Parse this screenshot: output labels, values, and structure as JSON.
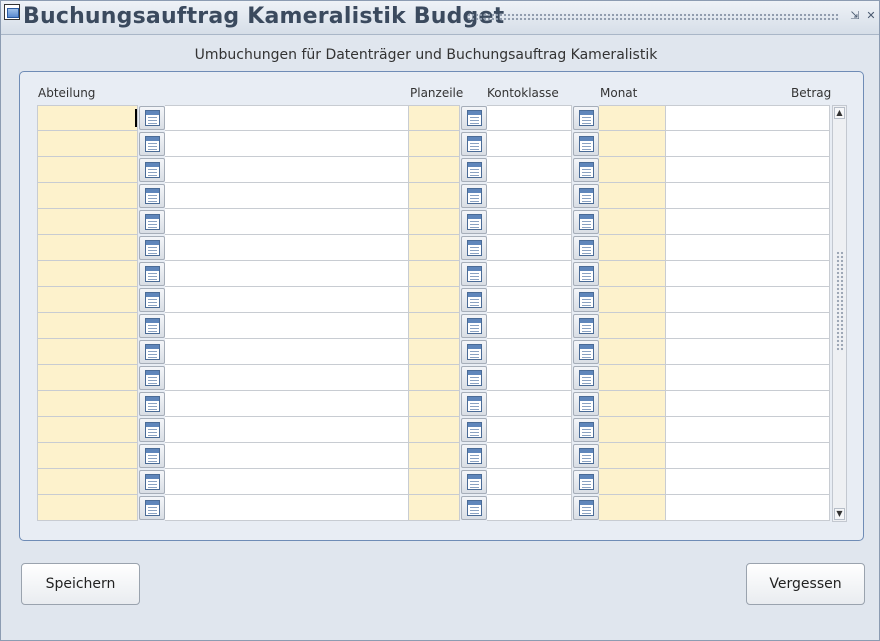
{
  "window": {
    "title": "Buchungsauftrag Kameralistik Budget",
    "minimize_glyph": "⇲",
    "close_glyph": "✕"
  },
  "subtitle": "Umbuchungen für Datenträger und Buchungsauftrag Kameralistik",
  "columns": {
    "abteilung": "Abteilung",
    "planzeile": "Planzeile",
    "kontoklasse": "Kontoklasse",
    "monat": "Monat",
    "betrag": "Betrag"
  },
  "rows": [
    {
      "abteilung": "",
      "abteilung_text": "",
      "planzeile": "",
      "kontoklasse": "",
      "monat": "",
      "betrag": ""
    },
    {
      "abteilung": "",
      "abteilung_text": "",
      "planzeile": "",
      "kontoklasse": "",
      "monat": "",
      "betrag": ""
    },
    {
      "abteilung": "",
      "abteilung_text": "",
      "planzeile": "",
      "kontoklasse": "",
      "monat": "",
      "betrag": ""
    },
    {
      "abteilung": "",
      "abteilung_text": "",
      "planzeile": "",
      "kontoklasse": "",
      "monat": "",
      "betrag": ""
    },
    {
      "abteilung": "",
      "abteilung_text": "",
      "planzeile": "",
      "kontoklasse": "",
      "monat": "",
      "betrag": ""
    },
    {
      "abteilung": "",
      "abteilung_text": "",
      "planzeile": "",
      "kontoklasse": "",
      "monat": "",
      "betrag": ""
    },
    {
      "abteilung": "",
      "abteilung_text": "",
      "planzeile": "",
      "kontoklasse": "",
      "monat": "",
      "betrag": ""
    },
    {
      "abteilung": "",
      "abteilung_text": "",
      "planzeile": "",
      "kontoklasse": "",
      "monat": "",
      "betrag": ""
    },
    {
      "abteilung": "",
      "abteilung_text": "",
      "planzeile": "",
      "kontoklasse": "",
      "monat": "",
      "betrag": ""
    },
    {
      "abteilung": "",
      "abteilung_text": "",
      "planzeile": "",
      "kontoklasse": "",
      "monat": "",
      "betrag": ""
    },
    {
      "abteilung": "",
      "abteilung_text": "",
      "planzeile": "",
      "kontoklasse": "",
      "monat": "",
      "betrag": ""
    },
    {
      "abteilung": "",
      "abteilung_text": "",
      "planzeile": "",
      "kontoklasse": "",
      "monat": "",
      "betrag": ""
    },
    {
      "abteilung": "",
      "abteilung_text": "",
      "planzeile": "",
      "kontoklasse": "",
      "monat": "",
      "betrag": ""
    },
    {
      "abteilung": "",
      "abteilung_text": "",
      "planzeile": "",
      "kontoklasse": "",
      "monat": "",
      "betrag": ""
    },
    {
      "abteilung": "",
      "abteilung_text": "",
      "planzeile": "",
      "kontoklasse": "",
      "monat": "",
      "betrag": ""
    },
    {
      "abteilung": "",
      "abteilung_text": "",
      "planzeile": "",
      "kontoklasse": "",
      "monat": "",
      "betrag": ""
    }
  ],
  "buttons": {
    "save": "Speichern",
    "cancel": "Vergessen"
  },
  "colors": {
    "required_field": "#fdf2cc",
    "panel_border": "#6f8cb6",
    "title_text": "#3b4a5e"
  },
  "icons": {
    "lov_button": "list-of-values-icon"
  }
}
